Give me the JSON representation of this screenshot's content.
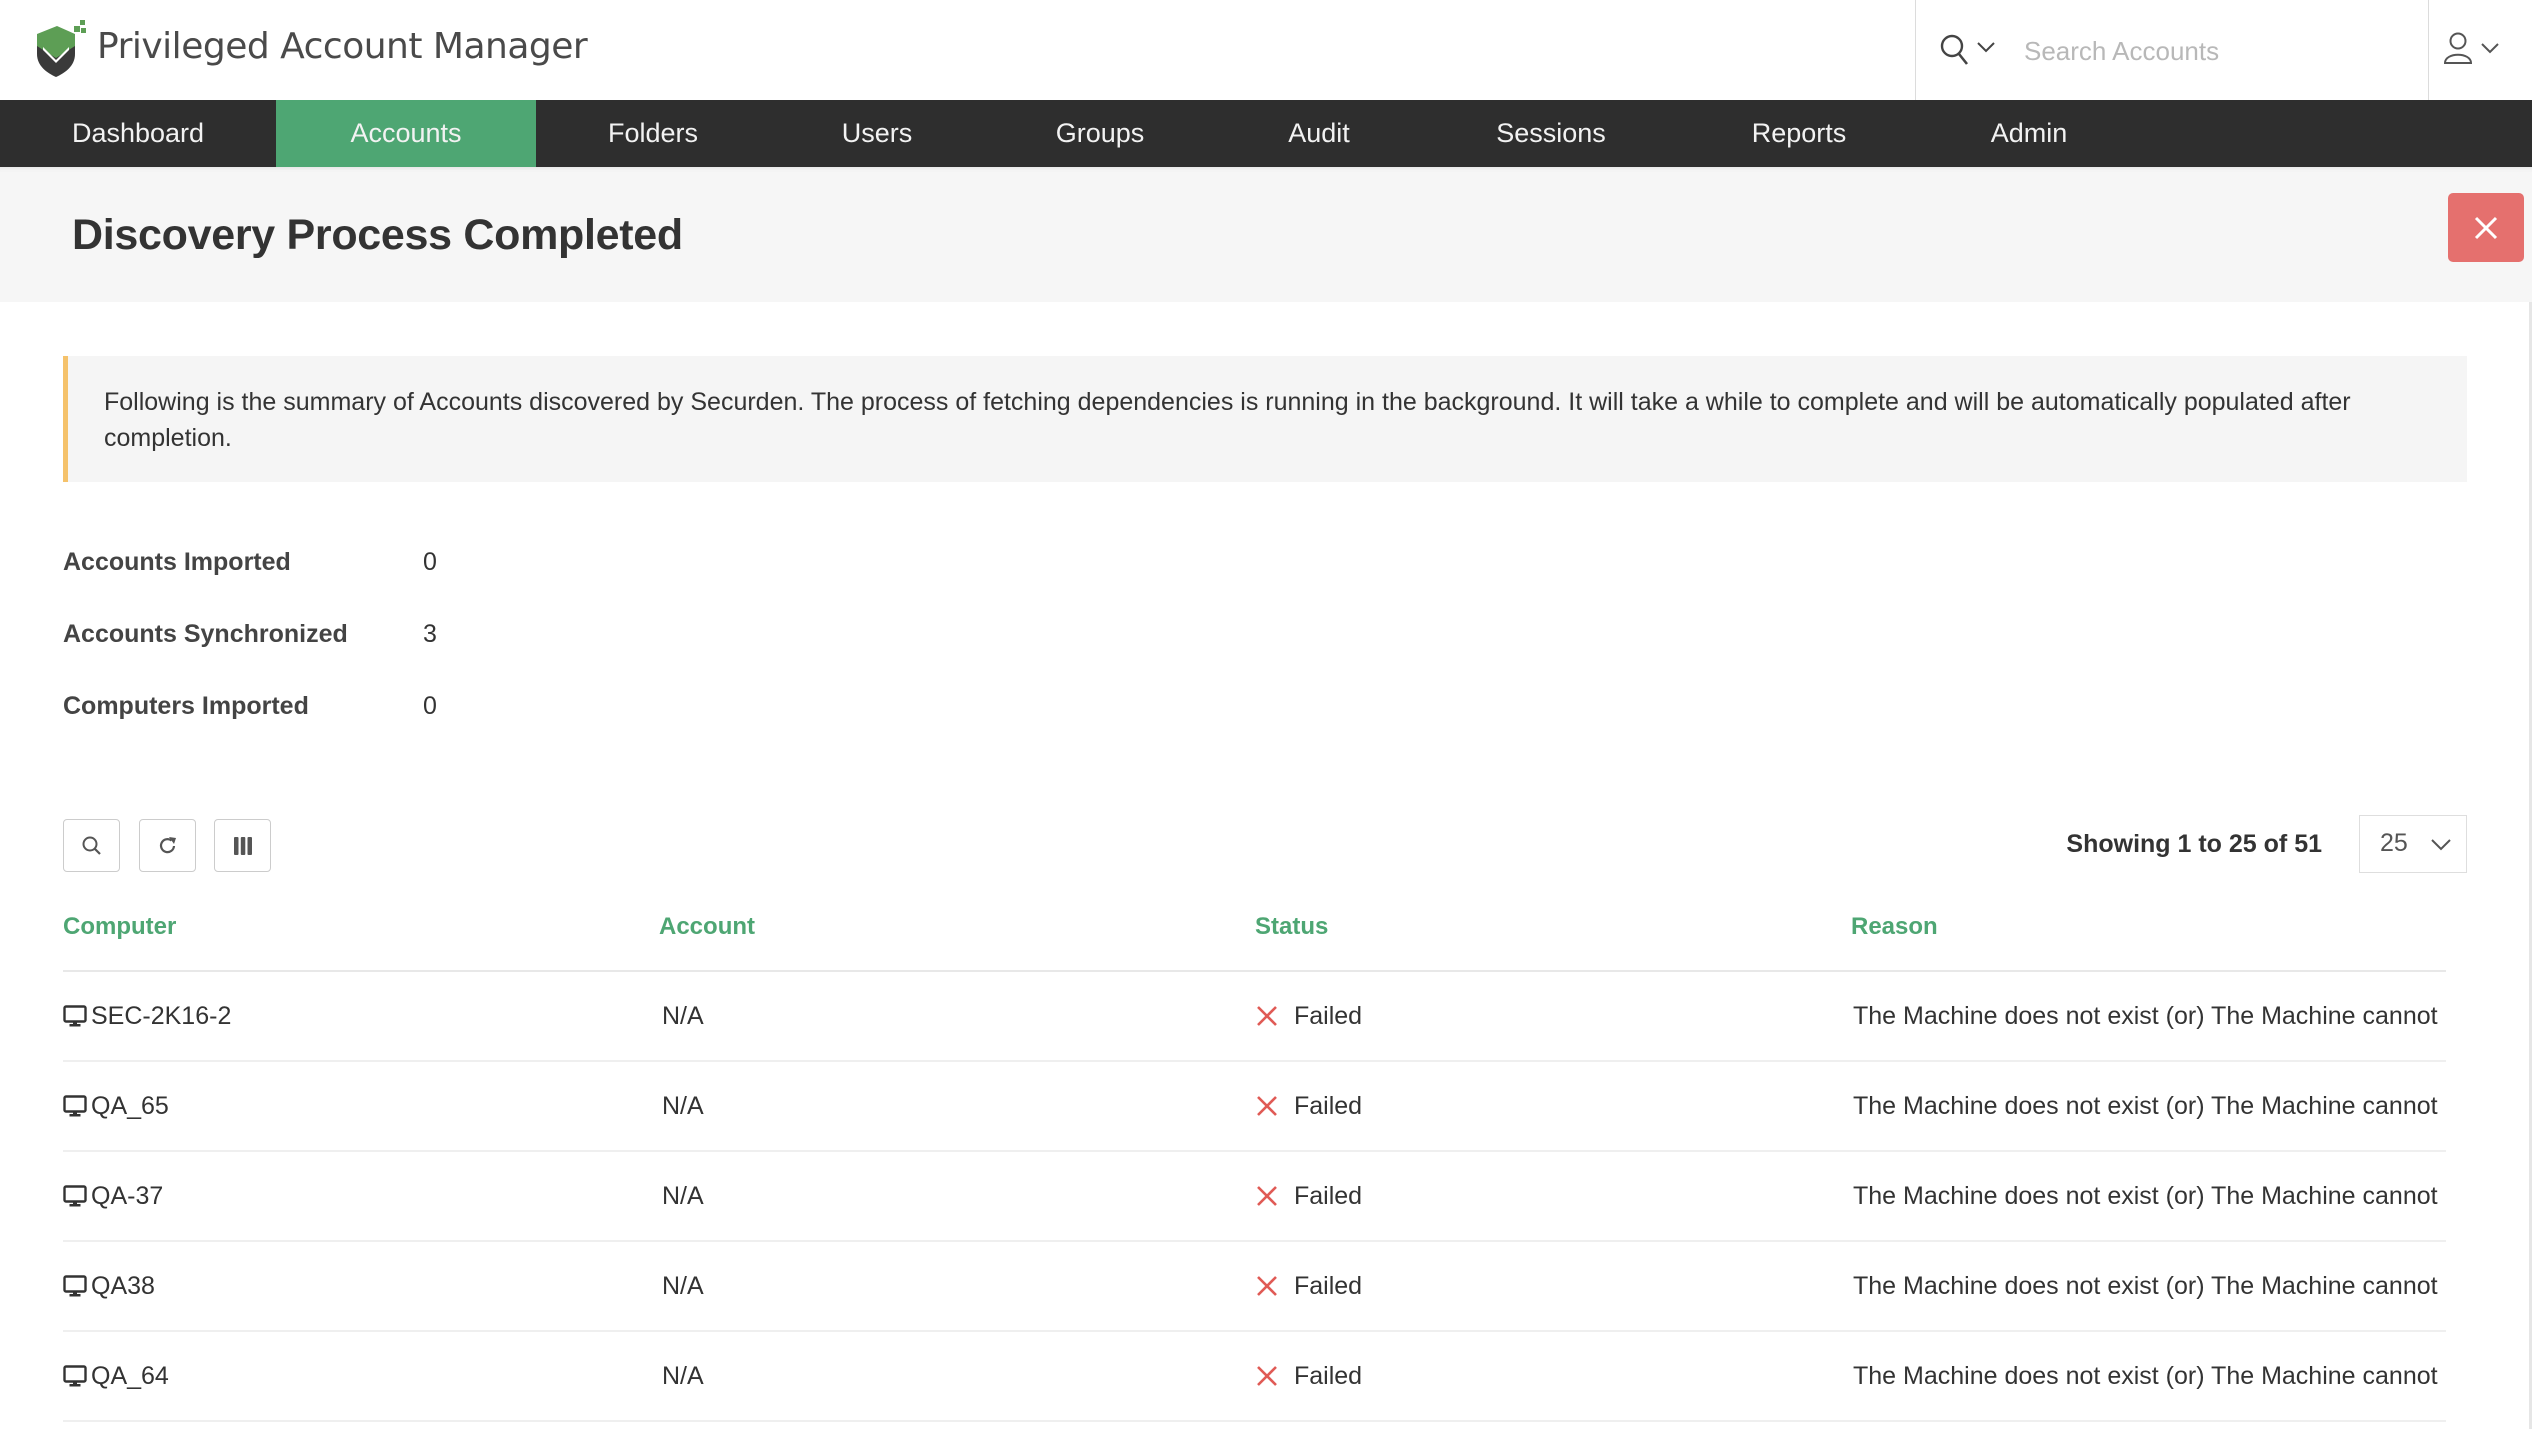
{
  "app": {
    "title": "Privileged Account Manager",
    "logo_icon": "shield-check-logo",
    "brand_green": "#4ea673"
  },
  "search": {
    "placeholder": "Search Accounts",
    "value": "",
    "icon": "search-icon"
  },
  "user_menu": {
    "icon": "user-icon"
  },
  "nav": {
    "items": [
      {
        "label": "Dashboard",
        "active": false
      },
      {
        "label": "Accounts",
        "active": true
      },
      {
        "label": "Folders",
        "active": false
      },
      {
        "label": "Users",
        "active": false
      },
      {
        "label": "Groups",
        "active": false
      },
      {
        "label": "Audit",
        "active": false
      },
      {
        "label": "Sessions",
        "active": false
      },
      {
        "label": "Reports",
        "active": false
      },
      {
        "label": "Admin",
        "active": false
      }
    ]
  },
  "page": {
    "title": "Discovery Process Completed",
    "close_icon": "close-icon"
  },
  "notice": {
    "text": "Following is the summary of Accounts discovered by Securden. The process of fetching dependencies is running in the background. It will take a while to complete and will be automatically populated after completion."
  },
  "stats": [
    {
      "label": "Accounts Imported",
      "value": "0"
    },
    {
      "label": "Accounts Synchronized",
      "value": "3"
    },
    {
      "label": "Computers Imported",
      "value": "0"
    }
  ],
  "toolbar": {
    "buttons": [
      "search-icon",
      "refresh-icon",
      "columns-icon"
    ],
    "showing": "Showing 1 to 25 of 51",
    "page_size": "25"
  },
  "table": {
    "columns": [
      "Computer",
      "Account",
      "Status",
      "Reason"
    ],
    "rows": [
      {
        "computer": "SEC-2K16-2",
        "account": "N/A",
        "status": "Failed",
        "reason": "The Machine does not exist (or) The Machine cannot"
      },
      {
        "computer": "QA_65",
        "account": "N/A",
        "status": "Failed",
        "reason": "The Machine does not exist (or) The Machine cannot"
      },
      {
        "computer": "QA-37",
        "account": "N/A",
        "status": "Failed",
        "reason": "The Machine does not exist (or) The Machine cannot"
      },
      {
        "computer": "QA38",
        "account": "N/A",
        "status": "Failed",
        "reason": "The Machine does not exist (or) The Machine cannot"
      },
      {
        "computer": "QA_64",
        "account": "N/A",
        "status": "Failed",
        "reason": "The Machine does not exist (or) The Machine cannot"
      }
    ]
  }
}
